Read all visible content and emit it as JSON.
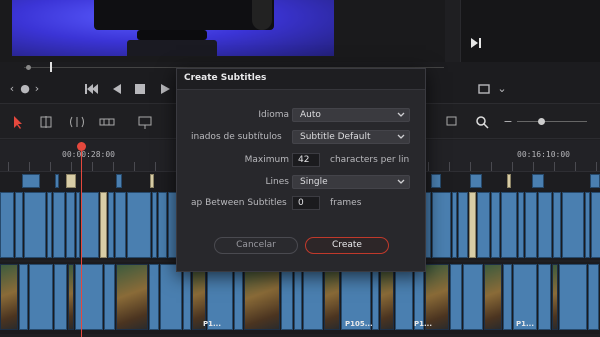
{
  "dialog": {
    "title": "Create Subtitles",
    "fields": {
      "language": {
        "label": "Idioma",
        "value": "Auto"
      },
      "caption_preset": {
        "label": "inados de subtítulos",
        "value": "Subtitle Default"
      },
      "max_chars": {
        "label": "Maximum",
        "value": "42",
        "suffix": "characters per lin"
      },
      "lines": {
        "label": "Lines",
        "value": "Single"
      },
      "gap": {
        "label": "ap Between Subtitles",
        "value": "0",
        "suffix": "frames"
      }
    },
    "buttons": {
      "cancel": "Cancelar",
      "create": "Create"
    }
  },
  "timeline": {
    "timecodes": [
      "00:00:28:00",
      "00:16:10:00"
    ],
    "clip_labels": [
      "P1...",
      "P105...",
      "P1...",
      "P1..."
    ]
  },
  "colors": {
    "accent": "#e5483d",
    "clip_blue": "#4a7fb0",
    "clip_cream": "#d8cda6",
    "create_border": "#c0392b"
  }
}
